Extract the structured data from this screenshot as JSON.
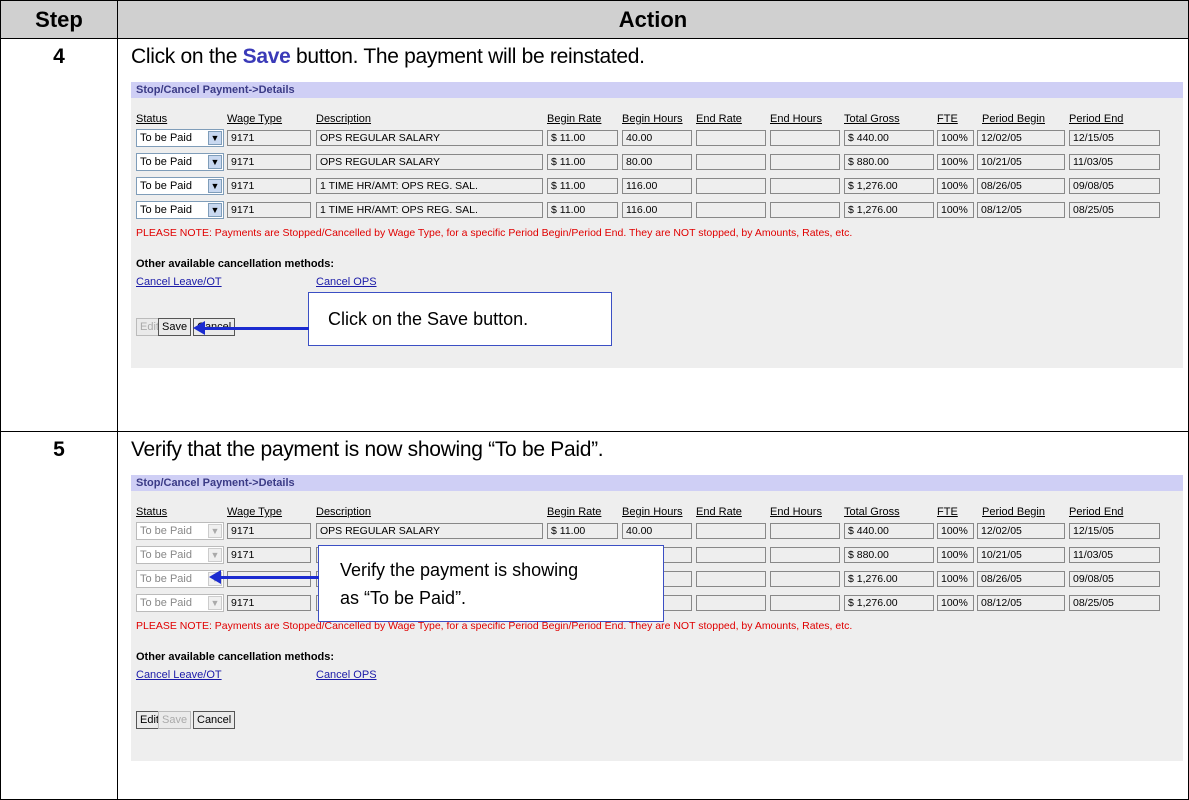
{
  "table": {
    "step_header": "Step",
    "action_header": "Action"
  },
  "steps": [
    {
      "number": "4",
      "text_before": "Click on the ",
      "text_highlight": "Save",
      "text_after": " button.  The payment will be reinstated.",
      "panel": {
        "title": "Stop/Cancel Payment->Details",
        "headers": [
          "Status",
          "Wage Type",
          "Description",
          "Begin Rate",
          "Begin Hours",
          "End Rate",
          "End Hours",
          "Total Gross",
          "FTE",
          "Period Begin",
          "Period End"
        ],
        "rows": [
          {
            "status": "To be Paid",
            "wage": "9171",
            "desc": "OPS REGULAR SALARY",
            "rate": "$ 11.00",
            "hours": "40.00",
            "end_rate": "",
            "end_hours": "",
            "gross": "$ 440.00",
            "fte": "100%",
            "pbegin": "12/02/05",
            "pend": "12/15/05"
          },
          {
            "status": "To be Paid",
            "wage": "9171",
            "desc": "OPS REGULAR SALARY",
            "rate": "$ 11.00",
            "hours": "80.00",
            "end_rate": "",
            "end_hours": "",
            "gross": "$ 880.00",
            "fte": "100%",
            "pbegin": "10/21/05",
            "pend": "11/03/05"
          },
          {
            "status": "To be Paid",
            "wage": "9171",
            "desc": "1 TIME HR/AMT: OPS REG. SAL.",
            "rate": "$ 11.00",
            "hours": "116.00",
            "end_rate": "",
            "end_hours": "",
            "gross": "$ 1,276.00",
            "fte": "100%",
            "pbegin": "08/26/05",
            "pend": "09/08/05"
          },
          {
            "status": "To be Paid",
            "wage": "9171",
            "desc": "1 TIME HR/AMT: OPS REG. SAL.",
            "rate": "$ 11.00",
            "hours": "116.00",
            "end_rate": "",
            "end_hours": "",
            "gross": "$ 1,276.00",
            "fte": "100%",
            "pbegin": "08/12/05",
            "pend": "08/25/05"
          }
        ],
        "note": "PLEASE NOTE: Payments are Stopped/Cancelled by Wage Type, for a specific Period Begin/Period End. They are NOT stopped, by Amounts, Rates, etc.",
        "other_label": "Other available cancellation methods:",
        "link_leave": "Cancel Leave/OT",
        "link_ops": "Cancel OPS",
        "btn_edit": "Edit",
        "btn_save": "Save",
        "btn_cancel": "Cancel"
      },
      "callout": "Click on the Save button."
    },
    {
      "number": "5",
      "text": "Verify that the payment is now showing “To be Paid”.",
      "panel": {
        "title": "Stop/Cancel Payment->Details",
        "headers": [
          "Status",
          "Wage Type",
          "Description",
          "Begin Rate",
          "Begin Hours",
          "End Rate",
          "End Hours",
          "Total Gross",
          "FTE",
          "Period Begin",
          "Period End"
        ],
        "rows": [
          {
            "status": "To be Paid",
            "wage": "9171",
            "desc": "OPS REGULAR SALARY",
            "rate": "$ 11.00",
            "hours": "40.00",
            "end_rate": "",
            "end_hours": "",
            "gross": "$ 440.00",
            "fte": "100%",
            "pbegin": "12/02/05",
            "pend": "12/15/05"
          },
          {
            "status": "To be Paid",
            "wage": "9171",
            "desc": "",
            "rate": "",
            "hours": "",
            "end_rate": "",
            "end_hours": "",
            "gross": "$ 880.00",
            "fte": "100%",
            "pbegin": "10/21/05",
            "pend": "11/03/05"
          },
          {
            "status": "To be Paid",
            "wage": "",
            "desc": "",
            "rate": "",
            "hours": "",
            "end_rate": "",
            "end_hours": "",
            "gross": "$ 1,276.00",
            "fte": "100%",
            "pbegin": "08/26/05",
            "pend": "09/08/05"
          },
          {
            "status": "To be Paid",
            "wage": "9171",
            "desc": "",
            "rate": "",
            "hours": "",
            "end_rate": "",
            "end_hours": "",
            "gross": "$ 1,276.00",
            "fte": "100%",
            "pbegin": "08/12/05",
            "pend": "08/25/05"
          }
        ],
        "note": "PLEASE NOTE: Payments are Stopped/Cancelled by Wage Type, for a specific Period Begin/Period End. They are NOT stopped, by Amounts, Rates, etc.",
        "other_label": "Other available cancellation methods:",
        "link_leave": "Cancel Leave/OT",
        "link_ops": "Cancel OPS",
        "btn_edit": "Edit",
        "btn_save": "Save",
        "btn_cancel": "Cancel"
      },
      "callout_line1": "Verify the payment is showing",
      "callout_line2": "as “To be Paid”."
    }
  ]
}
